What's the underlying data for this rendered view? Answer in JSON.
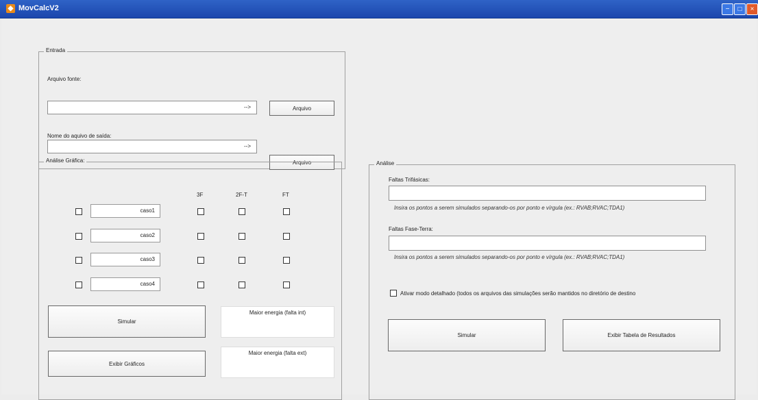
{
  "window": {
    "title": "MovCalcV2",
    "icon": "matlab-icon",
    "controls": [
      "minimize-icon",
      "maximize-icon",
      "close-icon"
    ]
  },
  "entrada": {
    "title": "Entrada",
    "source_label": "Arquivo fonte:",
    "source_value": "",
    "source_arrow": "-->",
    "source_button": "Arquivo",
    "output_label": "Nome do aquivo de saída:",
    "output_value": "",
    "output_arrow": "-->",
    "output_button": "Arquivo"
  },
  "analise_grafica": {
    "title": "Análise Gráfica:",
    "headers": [
      "3F",
      "2F-T",
      "FT"
    ],
    "cases": [
      "caso1",
      "caso2",
      "caso3",
      "caso4"
    ],
    "simulate_button": "Simular",
    "show_graphs_button": "Exibir Gráficos",
    "max_energy_int": "Maior energia (falta int)",
    "max_energy_ext": "Maior energia (falta ext)"
  },
  "analise": {
    "title": "Análise",
    "three_phase_label": "Faltas Trifásicas:",
    "three_phase_value": "",
    "three_phase_hint": "Insira os pontos a serem simulados separando-os por ponto e vírgula (ex.: RVAB;RVAC;TDA1)",
    "ground_fault_label": "Faltas Fase-Terra:",
    "ground_fault_value": "",
    "ground_fault_hint": "Insira os pontos a serem simulados separando-os por ponto e vírgula (ex.: RVAB;RVAC;TDA1)",
    "detailed_mode_label": "Ativar modo detalhado (todos os arquivos das simulações serão mantidos no diretório de destino",
    "simulate_button": "Simular",
    "results_table_button": "Exibir Tabela de Resultados"
  }
}
